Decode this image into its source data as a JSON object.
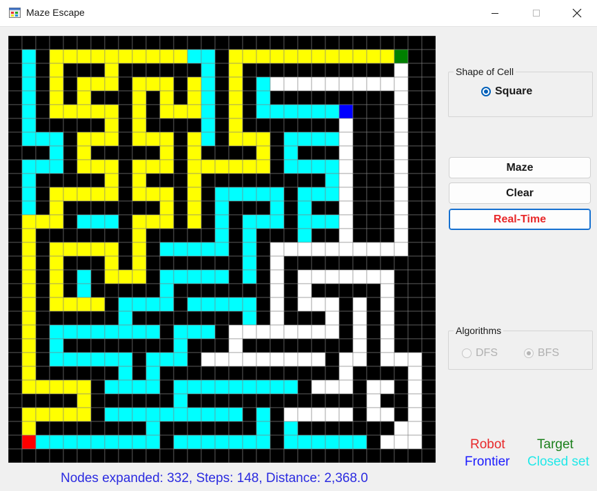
{
  "window": {
    "title": "Maze Escape",
    "icon": "app-window-icon",
    "controls": [
      "minimize-icon",
      "maximize-icon",
      "close-icon"
    ]
  },
  "maze": {
    "rows": 31,
    "cols": 31,
    "colors": {
      "wall": "#000000",
      "free": "#ffffff",
      "path": "#ffff00",
      "closed": "#00ffff",
      "robot": "#ff0000",
      "target": "#008000",
      "frontier": "#0000ff",
      "gridline": "#808080"
    },
    "grid": [
      "WWWWWWWWWWWWWWWWWWWWWWWWWWWWWWW",
      "WCWPPPPPPPPPPCCWPPPPPPPPPPPPTWW",
      "WCWPWWWPWWWWWWCWPWWWWWWWWWWWFWW",
      "WCWPWPPPWPPPWPCWPWCFFFFFFFFFFWW",
      "WCWPWPWWWPWPWPCWPWCWWWWWWWWWFWW",
      "WCWPPPPPWPWPPPCWPWCCCCCCRWWWFWW",
      "WCWWWWWPWPWWWWCWPWWWWWWWFWWWFWW",
      "WCCCWPPPWPPPWPCWPPPWCCCCFWWWFWW",
      "WWWCWPWWWWWPWPWWWWPWCWWWFWWWFWW",
      "WCCCWPPPWPPPWPPPPPPWCCCCFWWWFWW",
      "WCWWWWWPWPWWWPWWWWWWWWWCFWWWFWW",
      "WCWPPPPPWPPPWPWCCCCCWCCCFWWWFWW",
      "WCWPWWWWWWWPWPWCWWWCWCWWFWWWFWW",
      "WPPPWCCCWPPPWPWCWCCCWCCCFWWWFWW",
      "WPWWWWWWWPWWWWWCWCWWWCWWFWWWFWW",
      "WPWPPPPPWPWCCCCCWCWFFFFFFFFFFWW",
      "WPWPWWWPWPWWWWWWWCWFWWWWWWWWWWW",
      "WPWPWCWPPPWCCCCCWCWFWFFFFFFFWWW",
      "WPWPWCWWWWWCWWWWWWWFWFWWWWWFWWW",
      "WPWPPPPWCCCCWCCCCCWFWFFFWFWFWWW",
      "WPWWWWWWCWWWWWWWWCWFWWWFWFWFWWW",
      "WPWCCCCCCCCWCCCWFFFFFFFFWFWFWWW",
      "WPWCWWWWWWWWCWWWFWWWWWWWWFWFWWW",
      "WPWCCCCCCWCCCWFFFFFFFFFWFFWFFFW",
      "WPWWWWWWCWCWWWWWWWWWWWWWFWWWWFW",
      "WPPPPPWCCCCWCCCCCCCCCWFFFWFFWFW",
      "WWWWWPWWWWWWCWWWWWWWWWWWWWFWWFW",
      "WPPPPPWCCCCCCCCCCWCWFFFFFWFFWFW",
      "WPWWWWWWWWCWWWWWWWCWCWWWWWWWFFW",
      "WRCCCCCCCCCWCCCCCCCWCCCCCCWFFFW",
      "WWWWWWWWWWWWWWWWWWWWWWWWWWWWWWW"
    ]
  },
  "shape_group": {
    "title": "Shape of Cell",
    "option": "Square",
    "selected": true
  },
  "buttons": {
    "maze": "Maze",
    "clear": "Clear",
    "realtime": "Real-Time"
  },
  "algorithms_group": {
    "title": "Algorithms",
    "options": [
      "DFS",
      "BFS"
    ],
    "selected": "BFS",
    "enabled": false
  },
  "legend": {
    "robot": {
      "label": "Robot",
      "color": "#e8282a"
    },
    "target": {
      "label": "Target",
      "color": "#1a7f1a"
    },
    "frontier": {
      "label": "Frontier",
      "color": "#1a1aff"
    },
    "closed": {
      "label": "Closed set",
      "color": "#22e8e8"
    }
  },
  "status": {
    "text": "Nodes expanded: 332, Steps: 148, Distance: 2,368.0",
    "color": "#2a2ae0"
  }
}
